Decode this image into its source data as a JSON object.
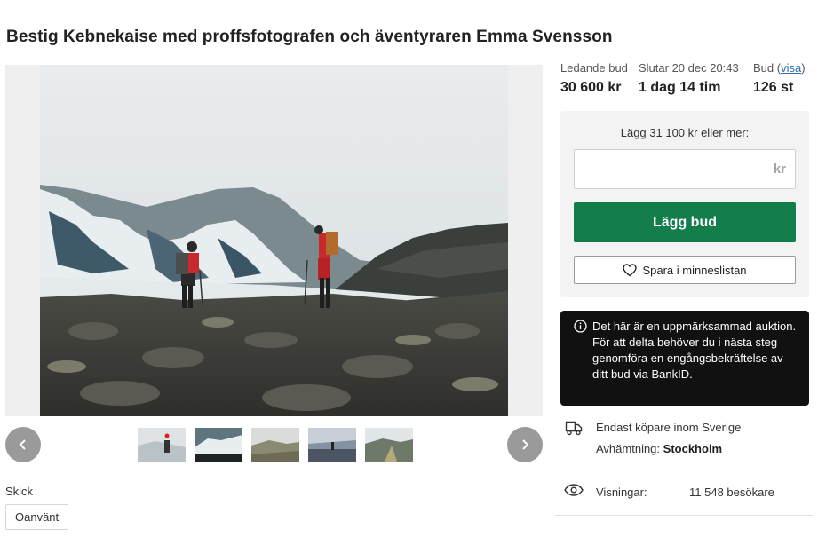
{
  "listing": {
    "title": "Bestig Kebnekaise med proffsfotografen och äventyraren Emma Svensson"
  },
  "gallery": {
    "prev_icon": "chevron-left-icon",
    "next_icon": "chevron-right-icon",
    "thumbnail_count": 5
  },
  "condition": {
    "label": "Skick",
    "value": "Oanvänt"
  },
  "stats": {
    "leading_bid_label": "Ledande bud",
    "leading_bid_value": "30 600 kr",
    "ends_label": "Slutar 20 dec 20:43",
    "ends_value": "1 dag 14 tim",
    "bids_label": "Bud (",
    "bids_link": "visa",
    "bids_close": ")",
    "bids_value": "126 st"
  },
  "bid_form": {
    "hint": "Lägg 31 100 kr eller mer:",
    "input_value": "",
    "currency_suffix": "kr",
    "submit_label": "Lägg bud",
    "watch_label": "Spara i minneslistan",
    "accent_color": "#137e4c"
  },
  "notice": {
    "text": "Det här är en uppmärksammad auktion. För att delta behöver du i nästa steg genomföra en engångsbekräftelse av ditt bud via BankID."
  },
  "shipping": {
    "restriction": "Endast köpare inom Sverige",
    "pickup_label": "Avhämtning:",
    "pickup_city": "Stockholm"
  },
  "views": {
    "label": "Visningar:",
    "value": "11 548 besökare"
  }
}
